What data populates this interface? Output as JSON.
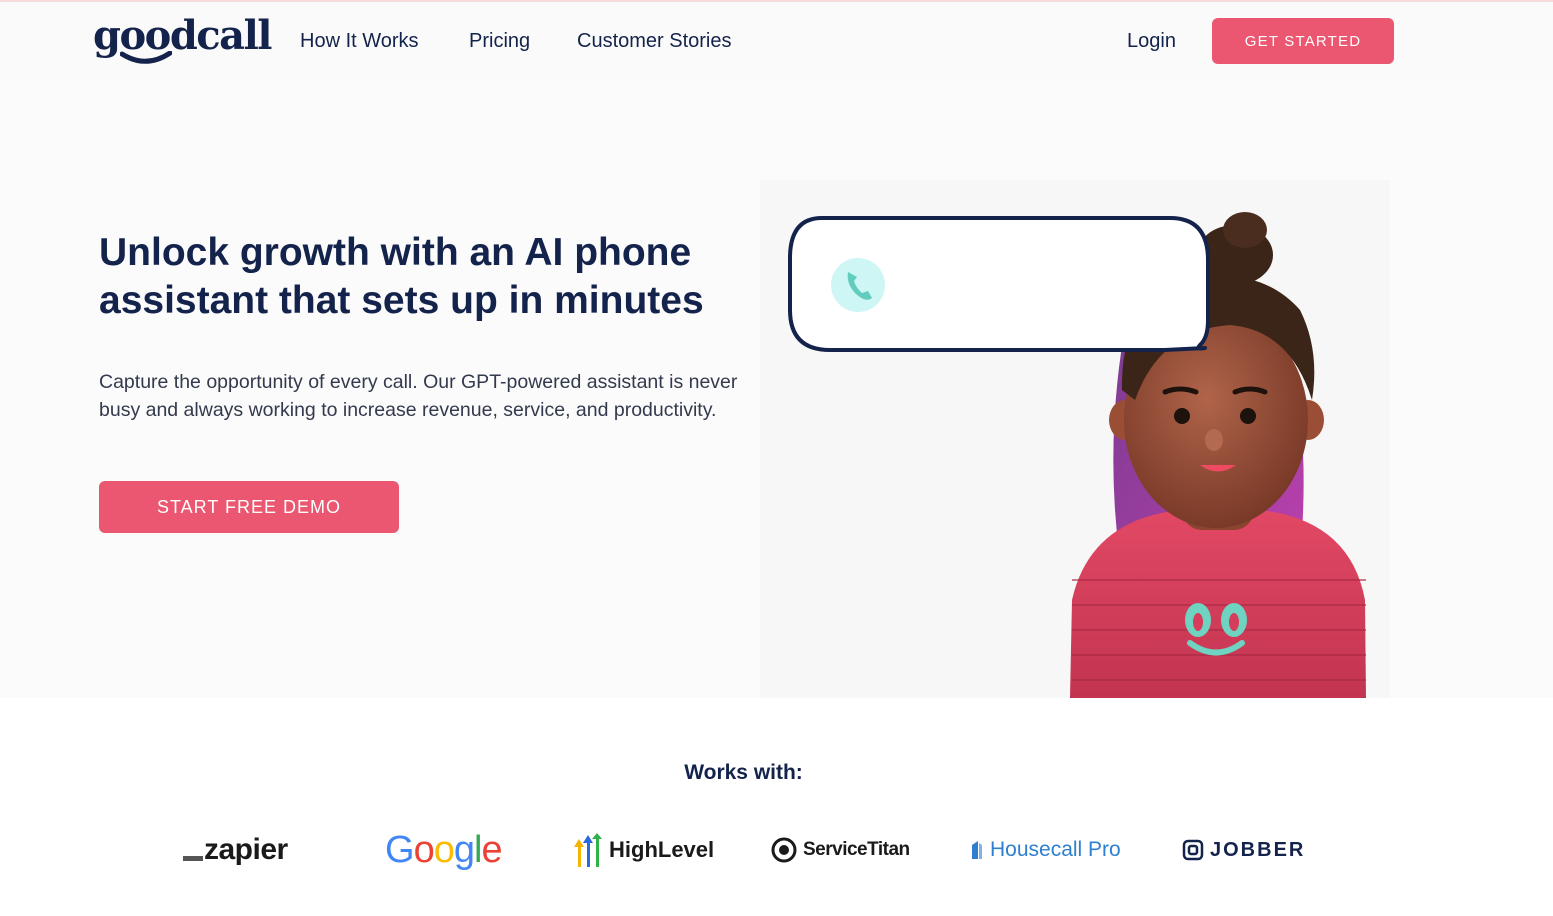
{
  "header": {
    "logo_text": "goodcall",
    "nav": {
      "how_it_works": "How It Works",
      "pricing": "Pricing",
      "customer_stories": "Customer Stories"
    },
    "login": "Login",
    "get_started": "GET STARTED"
  },
  "hero": {
    "title": "Unlock growth with an AI phone assistant that sets up in minutes",
    "subtitle": "Capture the opportunity of every call. Our GPT-powered assistant is never busy and always working to increase revenue, service, and productivity.",
    "cta": "START FREE DEMO"
  },
  "works_with": {
    "title": "Works with:",
    "partners": {
      "zapier": "zapier",
      "google": "Google",
      "highlevel": "HighLevel",
      "servicetitan": "ServiceTitan",
      "housecall": "Housecall Pro",
      "jobber": "JOBBER"
    }
  },
  "colors": {
    "brand_navy": "#14234b",
    "accent_pink": "#eb5670",
    "phone_bubble": "#cdf6f4",
    "phone_icon": "#63cdbd"
  },
  "icons": [
    "phone-icon",
    "smiley-shirt-icon"
  ]
}
